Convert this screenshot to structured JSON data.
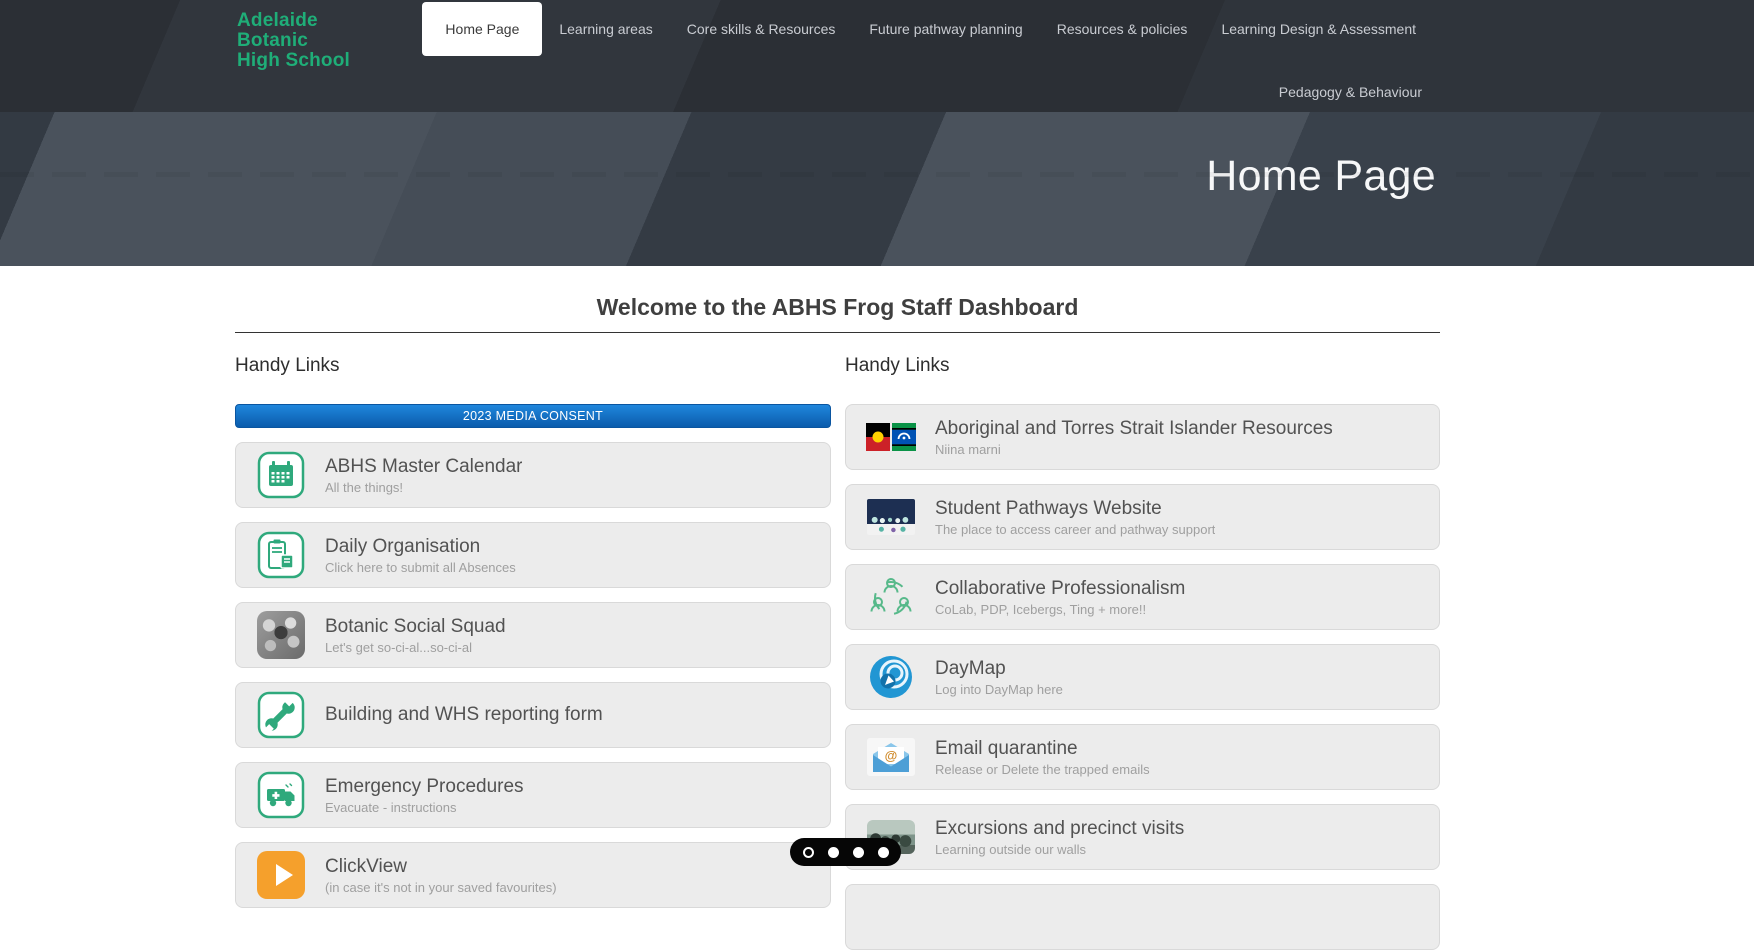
{
  "nav": {
    "logo_lines": [
      "Adelaide",
      "Botanic",
      "High School"
    ],
    "items": [
      {
        "label": "Home Page",
        "active": true
      },
      {
        "label": "Learning areas",
        "active": false
      },
      {
        "label": "Core skills & Resources",
        "active": false
      },
      {
        "label": "Future pathway planning",
        "active": false
      },
      {
        "label": "Resources & policies",
        "active": false
      },
      {
        "label": "Learning Design & Assessment",
        "active": false
      }
    ],
    "second_row_label": "Pedagogy & Behaviour"
  },
  "hero": {
    "title": "Home Page"
  },
  "main": {
    "welcome_heading": "Welcome to the ABHS Frog Staff Dashboard"
  },
  "left_column": {
    "heading": "Handy Links",
    "banner_button_label": "2023 MEDIA CONSENT",
    "items": [
      {
        "icon": "calendar-icon",
        "title": "ABHS Master Calendar",
        "subtitle": "All the things!"
      },
      {
        "icon": "clipboard-icon",
        "title": "Daily Organisation",
        "subtitle": "Click here to submit all Absences"
      },
      {
        "icon": "flower-photo-icon",
        "title": "Botanic Social Squad",
        "subtitle": "Let's get so-ci-al...so-ci-al"
      },
      {
        "icon": "wrench-icon",
        "title": "Building and WHS reporting form",
        "subtitle": ""
      },
      {
        "icon": "ambulance-icon",
        "title": "Emergency Procedures",
        "subtitle": "Evacuate - instructions"
      },
      {
        "icon": "play-icon",
        "title": "ClickView",
        "subtitle": "(in case it's not in your saved favourites)"
      }
    ]
  },
  "right_column": {
    "heading": "Handy Links",
    "items": [
      {
        "icon": "aboriginal-tsi-flags-icon",
        "title": "Aboriginal and Torres Strait Islander Resources",
        "subtitle": "Niina marni"
      },
      {
        "icon": "pathways-photo-icon",
        "title": "Student Pathways Website",
        "subtitle": "The place to access career and pathway support"
      },
      {
        "icon": "collaboration-icon",
        "title": "Collaborative Professionalism",
        "subtitle": "CoLab, PDP, Icebergs, Ting + more!!"
      },
      {
        "icon": "daymap-logo-icon",
        "title": "DayMap",
        "subtitle": "Log into DayMap here"
      },
      {
        "icon": "email-at-icon",
        "title": "Email quarantine",
        "subtitle": "Release or Delete the trapped emails"
      },
      {
        "icon": "excursion-photo-icon",
        "title": "Excursions and precinct visits",
        "subtitle": "Learning outside our walls"
      }
    ]
  },
  "carousel": {
    "dot_count": 4,
    "active_dot_index": 0
  },
  "colors": {
    "brand_green": "#1fae78",
    "nav_bg": "#2c3036",
    "hero_light": "#4a525c",
    "banner_button_blue_top": "#1f86dc",
    "banner_button_blue_bottom": "#0b5cac",
    "card_bg": "#ececec",
    "icon_green": "#2fa97c",
    "clickview_orange": "#f5a02c",
    "daymap_blue": "#2196d3"
  }
}
